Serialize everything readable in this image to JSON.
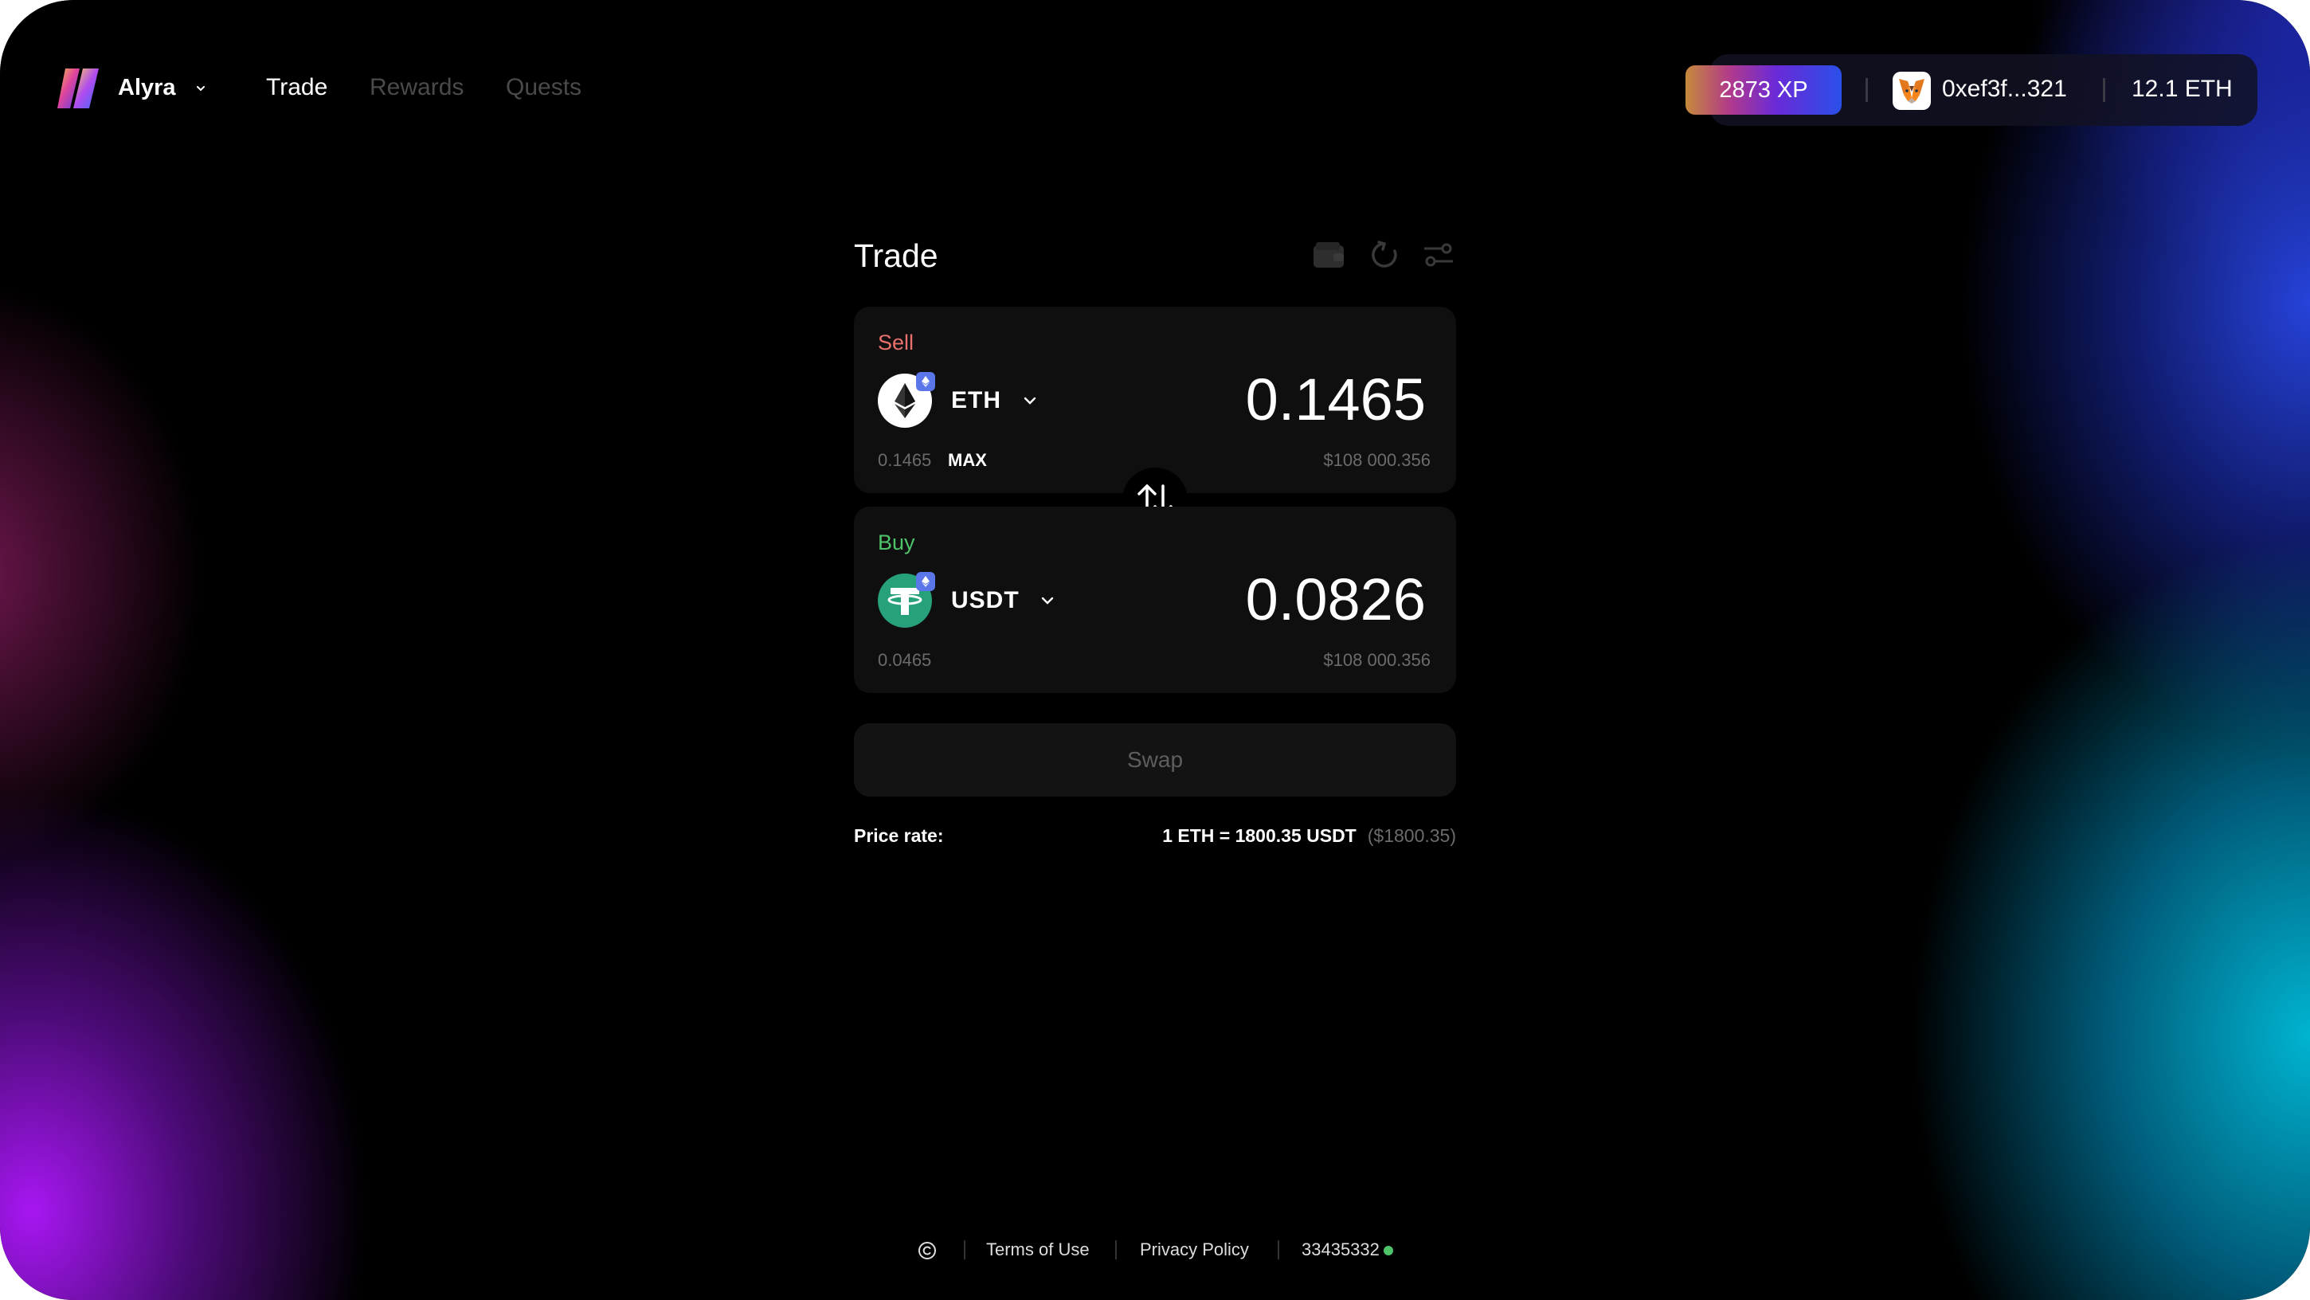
{
  "nav": {
    "brand": "Alyra",
    "links": [
      {
        "label": "Trade",
        "active": true
      },
      {
        "label": "Rewards",
        "active": false
      },
      {
        "label": "Quests",
        "active": false
      }
    ]
  },
  "account": {
    "xp": "2873 XP",
    "address": "0xef3f...321",
    "balance": "12.1 ETH"
  },
  "trade": {
    "title": "Trade",
    "tools": [
      "wallet-icon",
      "refresh-icon",
      "settings-sliders-icon"
    ],
    "sell": {
      "label": "Sell",
      "token": "ETH",
      "amount": "0.1465",
      "balance": "0.1465",
      "max_label": "MAX",
      "usd_value": "$108 000.356"
    },
    "buy": {
      "label": "Buy",
      "token": "USDT",
      "amount": "0.0826",
      "balance": "0.0465",
      "usd_value": "$108 000.356"
    },
    "swap_button": "Swap",
    "price_rate": {
      "label": "Price rate:",
      "value": "1 ETH = 1800.35 USDT",
      "usd": "($1800.35)"
    }
  },
  "footer": {
    "copyright_icon": "copyright-icon",
    "terms": "Terms of Use",
    "privacy": "Privacy Policy",
    "block": "33435332",
    "status_color": "#4fc36a"
  },
  "colors": {
    "sell_label": "#e9716d",
    "buy_label": "#4fc36a",
    "usdt_green": "#26a17b",
    "chain_badge": "#5b76e8"
  }
}
